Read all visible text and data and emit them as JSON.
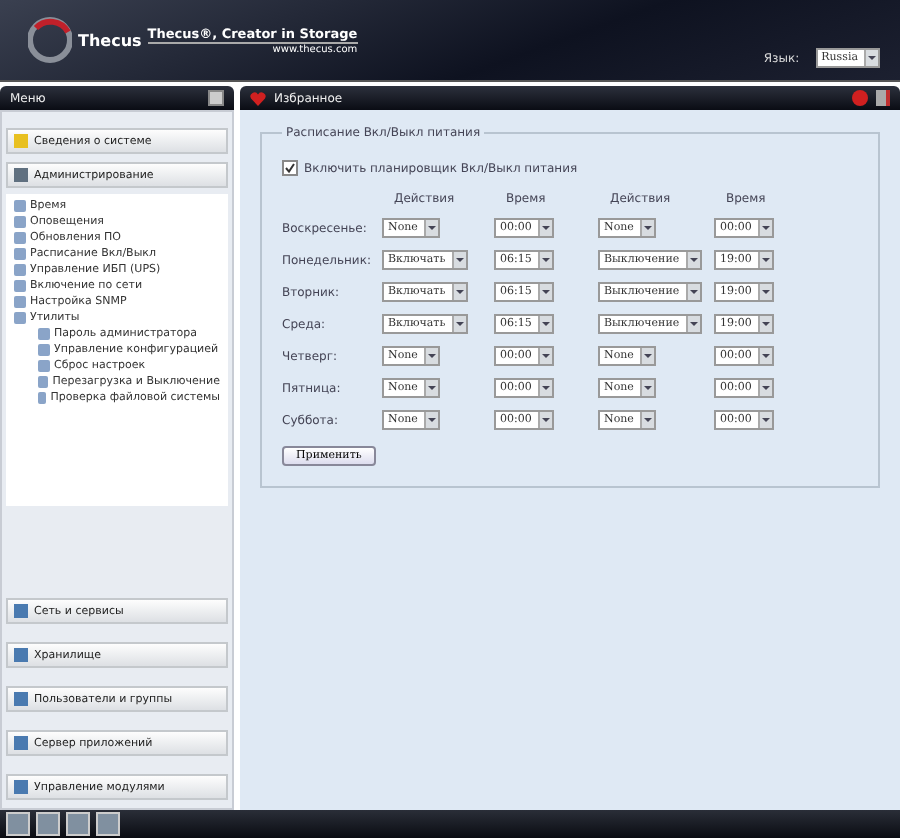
{
  "header": {
    "logo": "Thecus",
    "tagline": "Thecus®, Creator in Storage",
    "url": "www.thecus.com",
    "language_label": "Язык:",
    "language_value": "Russia"
  },
  "sidebar": {
    "title": "Меню",
    "sections_top": [
      {
        "label": "Сведения о системе"
      },
      {
        "label": "Администрирование",
        "children": [
          {
            "label": "Время"
          },
          {
            "label": "Оповещения"
          },
          {
            "label": "Обновления ПО"
          },
          {
            "label": "Расписание Вкл/Выкл"
          },
          {
            "label": "Управление ИБП (UPS)"
          },
          {
            "label": "Включение по сети"
          },
          {
            "label": "Настройка SNMP"
          },
          {
            "label": "Утилиты",
            "children": [
              {
                "label": "Пароль администратора"
              },
              {
                "label": "Управление конфигурацией"
              },
              {
                "label": "Сброс настроек"
              },
              {
                "label": "Перезагрузка и Выключение"
              },
              {
                "label": "Проверка файловой системы"
              }
            ]
          }
        ]
      }
    ],
    "sections_bottom": [
      {
        "label": "Сеть и сервисы"
      },
      {
        "label": "Хранилище"
      },
      {
        "label": "Пользователи и группы"
      },
      {
        "label": "Сервер приложений"
      },
      {
        "label": "Управление модулями"
      }
    ]
  },
  "content": {
    "title": "Избранное",
    "fieldset_title": "Расписание Вкл/Выкл питания",
    "enable": {
      "label": "Включить планировщик Вкл/Выкл питания",
      "checked": true
    },
    "columns": [
      "Действия",
      "Время",
      "Действия",
      "Время"
    ],
    "rows": [
      {
        "day": "Воскресенье:",
        "action1": "None",
        "time1": "00:00",
        "action2": "None",
        "time2": "00:00"
      },
      {
        "day": "Понедельник:",
        "action1": "Включать",
        "time1": "06:15",
        "action2": "Выключение",
        "time2": "19:00"
      },
      {
        "day": "Вторник:",
        "action1": "Включать",
        "time1": "06:15",
        "action2": "Выключение",
        "time2": "19:00"
      },
      {
        "day": "Среда:",
        "action1": "Включать",
        "time1": "06:15",
        "action2": "Выключение",
        "time2": "19:00"
      },
      {
        "day": "Четверг:",
        "action1": "None",
        "time1": "00:00",
        "action2": "None",
        "time2": "00:00"
      },
      {
        "day": "Пятница:",
        "action1": "None",
        "time1": "00:00",
        "action2": "None",
        "time2": "00:00"
      },
      {
        "day": "Суббота:",
        "action1": "None",
        "time1": "00:00",
        "action2": "None",
        "time2": "00:00"
      }
    ],
    "apply_button": "Применить"
  }
}
